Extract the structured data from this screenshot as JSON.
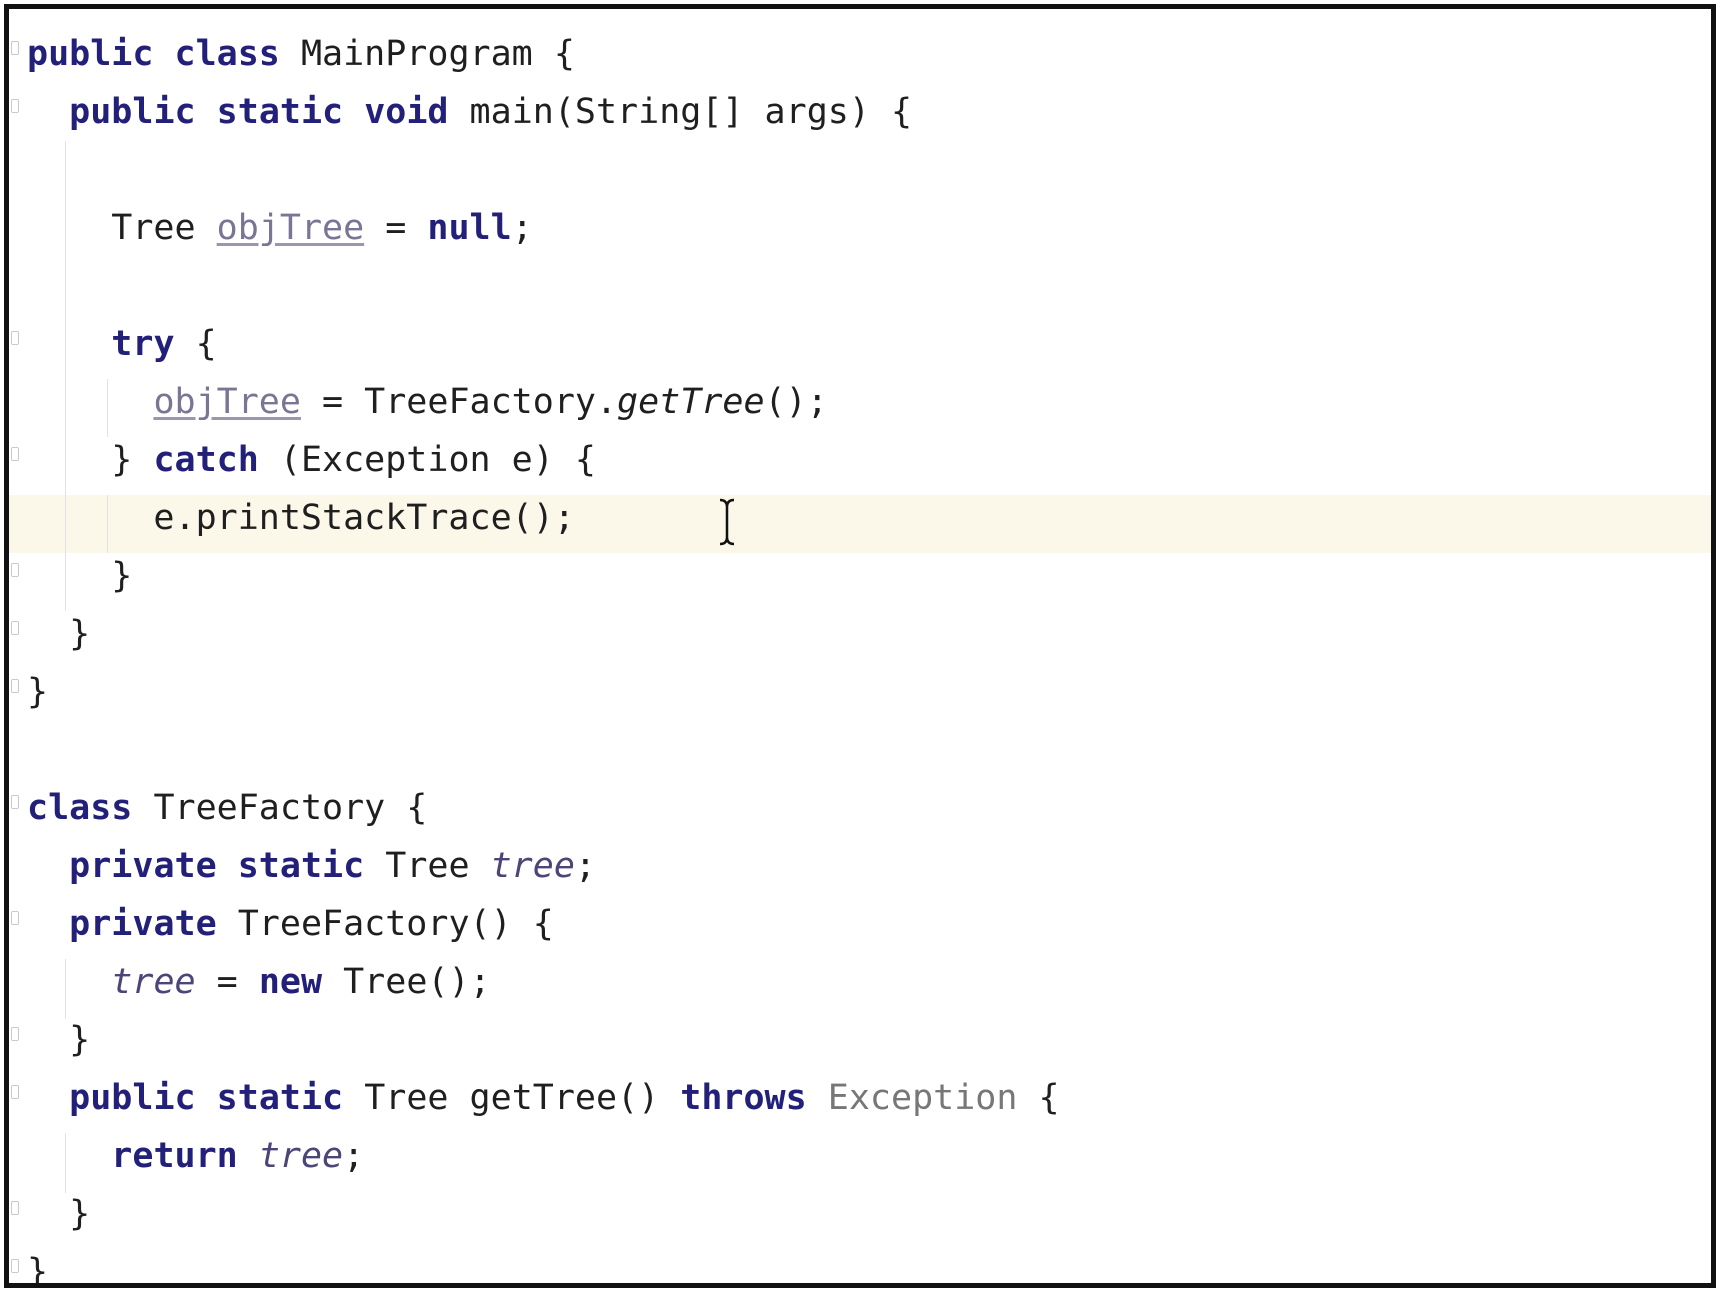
{
  "editor": {
    "lines": [
      {
        "tokens": [
          {
            "t": "public ",
            "k": "kw"
          },
          {
            "t": "class ",
            "k": "kw"
          },
          {
            "t": "MainProgram {",
            "k": ""
          }
        ]
      },
      {
        "tokens": [
          {
            "t": "  ",
            "k": ""
          },
          {
            "t": "public ",
            "k": "kw"
          },
          {
            "t": "static ",
            "k": "kw"
          },
          {
            "t": "void ",
            "k": "kw"
          },
          {
            "t": "main(String[] args) {",
            "k": ""
          }
        ]
      },
      {
        "tokens": []
      },
      {
        "tokens": [
          {
            "t": "    Tree ",
            "k": ""
          },
          {
            "t": "objTree",
            "k": "warn"
          },
          {
            "t": " = ",
            "k": ""
          },
          {
            "t": "null",
            "k": "kw"
          },
          {
            "t": ";",
            "k": ""
          }
        ]
      },
      {
        "tokens": []
      },
      {
        "tokens": [
          {
            "t": "    ",
            "k": ""
          },
          {
            "t": "try",
            "k": "kw"
          },
          {
            "t": " {",
            "k": ""
          }
        ]
      },
      {
        "tokens": [
          {
            "t": "      ",
            "k": ""
          },
          {
            "t": "objTree",
            "k": "warn"
          },
          {
            "t": " = TreeFactory.",
            "k": ""
          },
          {
            "t": "getTree",
            "k": "ital"
          },
          {
            "t": "();",
            "k": ""
          }
        ]
      },
      {
        "tokens": [
          {
            "t": "    } ",
            "k": ""
          },
          {
            "t": "catch",
            "k": "kw"
          },
          {
            "t": " (Exception e) {",
            "k": ""
          }
        ]
      },
      {
        "tokens": [
          {
            "t": "      e.printStackTrace();",
            "k": ""
          }
        ]
      },
      {
        "tokens": [
          {
            "t": "    }",
            "k": ""
          }
        ]
      },
      {
        "tokens": [
          {
            "t": "  }",
            "k": ""
          }
        ]
      },
      {
        "tokens": [
          {
            "t": "}",
            "k": ""
          }
        ]
      },
      {
        "tokens": []
      },
      {
        "tokens": [
          {
            "t": "class ",
            "k": "kw"
          },
          {
            "t": "TreeFactory {",
            "k": ""
          }
        ]
      },
      {
        "tokens": [
          {
            "t": "  ",
            "k": ""
          },
          {
            "t": "private ",
            "k": "kw"
          },
          {
            "t": "static ",
            "k": "kw"
          },
          {
            "t": "Tree ",
            "k": ""
          },
          {
            "t": "tree",
            "k": "fld"
          },
          {
            "t": ";",
            "k": ""
          }
        ]
      },
      {
        "tokens": [
          {
            "t": "  ",
            "k": ""
          },
          {
            "t": "private ",
            "k": "kw"
          },
          {
            "t": "TreeFactory() {",
            "k": ""
          }
        ]
      },
      {
        "tokens": [
          {
            "t": "    ",
            "k": ""
          },
          {
            "t": "tree",
            "k": "fld"
          },
          {
            "t": " = ",
            "k": ""
          },
          {
            "t": "new ",
            "k": "kw"
          },
          {
            "t": "Tree();",
            "k": ""
          }
        ]
      },
      {
        "tokens": [
          {
            "t": "  }",
            "k": ""
          }
        ]
      },
      {
        "tokens": [
          {
            "t": "  ",
            "k": ""
          },
          {
            "t": "public ",
            "k": "kw"
          },
          {
            "t": "static ",
            "k": "kw"
          },
          {
            "t": "Tree getTree() ",
            "k": ""
          },
          {
            "t": "throws ",
            "k": "kw"
          },
          {
            "t": "Exception",
            "k": "muted"
          },
          {
            "t": " {",
            "k": ""
          }
        ]
      },
      {
        "tokens": [
          {
            "t": "    ",
            "k": ""
          },
          {
            "t": "return ",
            "k": "kw"
          },
          {
            "t": "tree",
            "k": "fld"
          },
          {
            "t": ";",
            "k": ""
          }
        ]
      },
      {
        "tokens": [
          {
            "t": "  }",
            "k": ""
          }
        ]
      },
      {
        "tokens": [
          {
            "t": "}",
            "k": ""
          }
        ]
      }
    ],
    "colors": {
      "keyword": "#23207a",
      "field": "#4b4578",
      "unused_warning": "#7a7595",
      "muted_type": "#777777",
      "current_line": "#fbf8ea",
      "text": "#1f1f1f"
    },
    "cursor_icon": "text-cursor-icon"
  }
}
